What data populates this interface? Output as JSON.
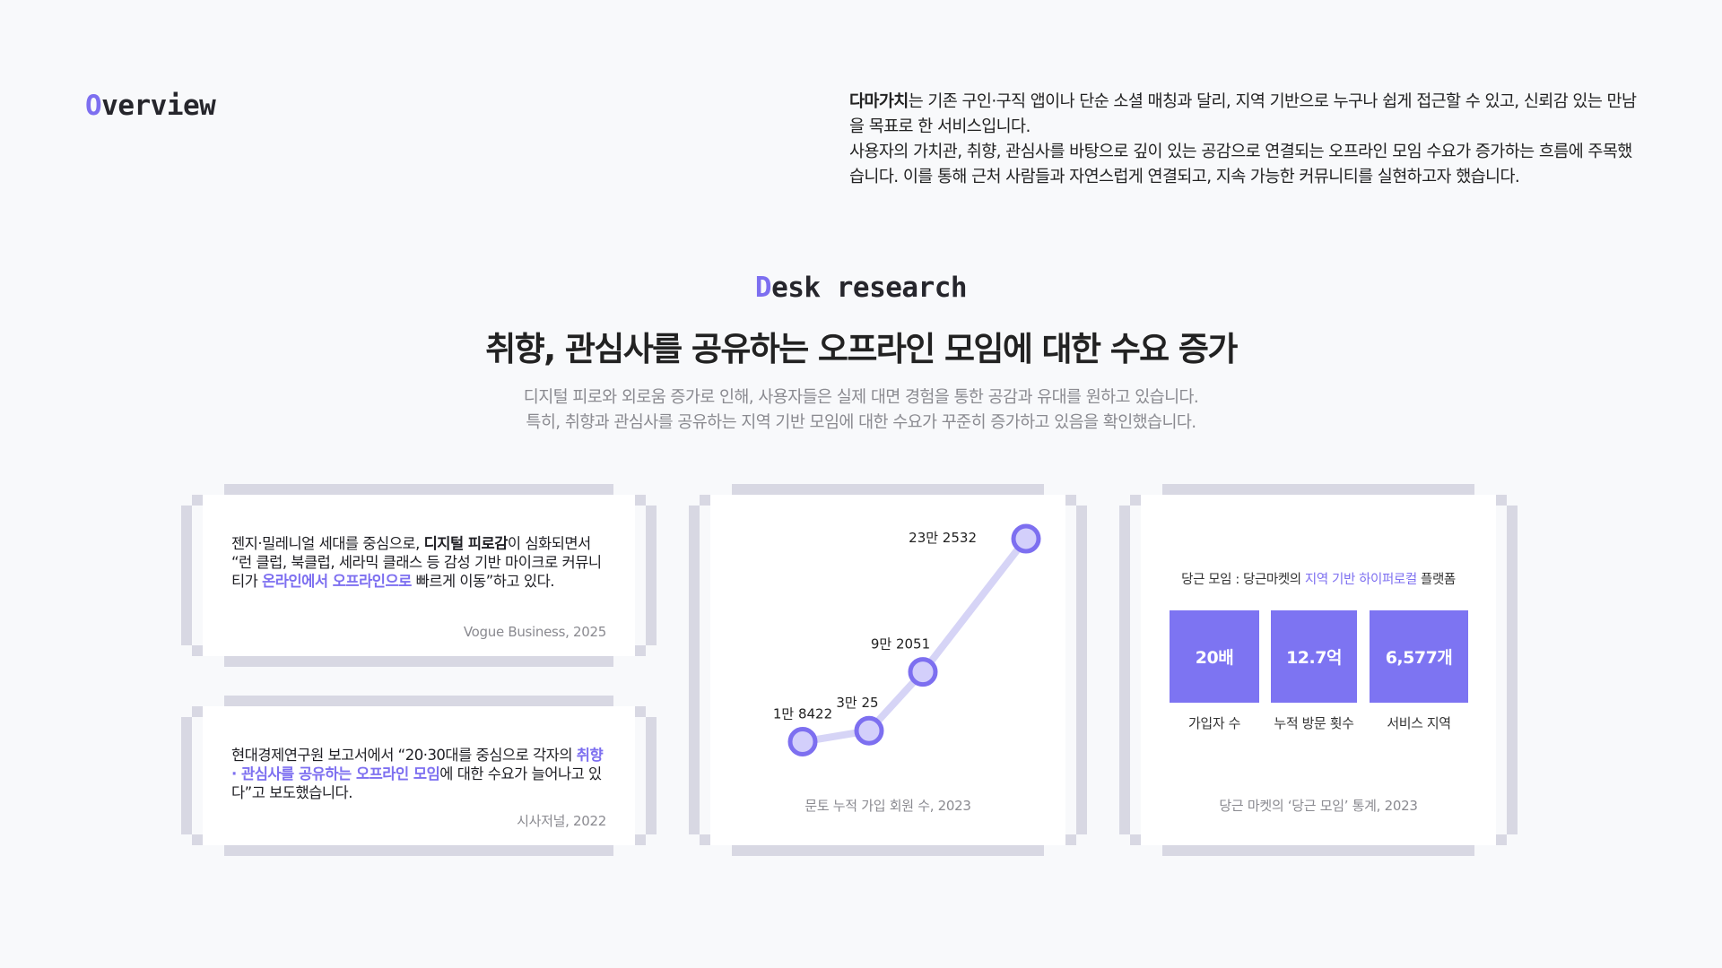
{
  "overview": {
    "title_initial": "O",
    "title_rest": "verview",
    "brand": "다마가치",
    "text_line1": "는 기존 구인·구직 앱이나 단순 소셜 매칭과 달리, 지역 기반으로 누구나 쉽게 접근할 수 있고, 신뢰감 있는 만남을 목표로 한 서비스입니다.",
    "text_line2": "사용자의 가치관, 취향, 관심사를 바탕으로 깊이 있는 공감으로 연결되는 오프라인 모임 수요가 증가하는 흐름에 주목했습니다. 이를 통해 근처 사람들과 자연스럽게 연결되고, 지속 가능한 커뮤니티를 실현하고자 했습니다."
  },
  "desk": {
    "title_initial": "D",
    "title_rest": "esk research",
    "heading": "취향, 관심사를 공유하는 오프라인 모임에 대한 수요 증가",
    "sub_line1": "디지털 피로와 외로움 증가로 인해, 사용자들은 실제 대면 경험을 통한 공감과 유대를 원하고 있습니다.",
    "sub_line2": "특히, 취향과 관심사를 공유하는 지역 기반 모임에 대한 수요가 꾸준히 증가하고 있음을 확인했습니다."
  },
  "card1": {
    "p1": "젠지·밀레니얼 세대를 중심으로, ",
    "bold": "디지털 피로감",
    "p2": "이 심화되면서 “런 클럽, 북클럽, 세라믹 클래스 등 감성 기반 마이크로 커뮤니티가 ",
    "hl": "온라인에서 오프라인으로",
    "p3": " 빠르게 이동”하고 있다.",
    "source": "Vogue Business, 2025"
  },
  "card2": {
    "p1": "현대경제연구원 보고서에서 “20·30대를 중심으로 각자의 ",
    "hl": "취향 · 관심사를 공유하는 오프라인 모임",
    "p2": "에 대한 수요가 늘어나고 있다”고 보도했습니다.",
    "source": "시사저널, 2022"
  },
  "chart": {
    "caption": "문토 누적 가입 회원 수, 2023",
    "line_color": "#d6d4f6",
    "dot_color": "#7d6ff0",
    "dot_fill": "#d3cffb"
  },
  "chart_data": {
    "type": "line",
    "title": "",
    "xlabel": "",
    "ylabel": "",
    "x": [
      1,
      2,
      3,
      4
    ],
    "y": [
      18422,
      30025,
      92051,
      232532
    ],
    "labels": [
      "1만 8422",
      "3만 25",
      "9만 2051",
      "23만 2532"
    ]
  },
  "card3": {
    "title_p1": "당근 모임 : 당근마켓의 ",
    "title_hl": "지역 기반 하이퍼로컬",
    "title_p2": " 플랫폼",
    "stats": [
      {
        "value": "20배",
        "label": "가입자 수"
      },
      {
        "value": "12.7억",
        "label": "누적 방문 횟수"
      },
      {
        "value": "6,577개",
        "label": "서비스 지역"
      }
    ],
    "caption": "당근 마켓의 ‘당근 모임’ 통계, 2023",
    "accent": "#7d74f2"
  }
}
